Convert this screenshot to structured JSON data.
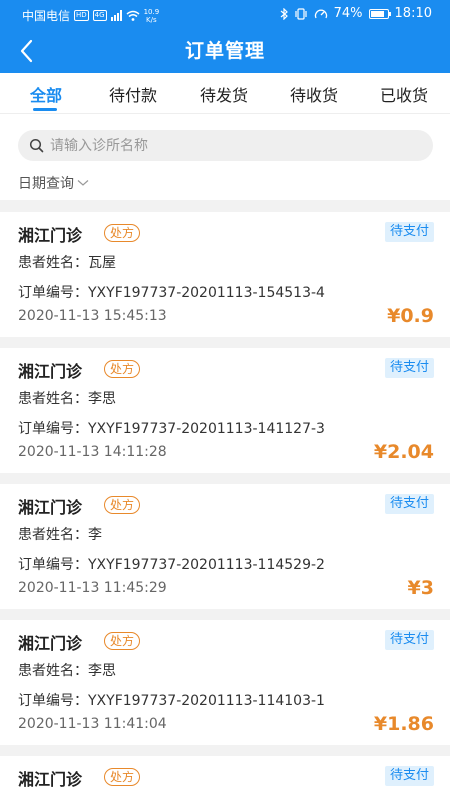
{
  "status_bar": {
    "carrier": "中国电信",
    "hd_badge": "HD",
    "net_badge": "4G",
    "speed": "10.9",
    "speed_unit": "K/s",
    "battery": "74%",
    "time": "18:10"
  },
  "nav": {
    "title": "订单管理"
  },
  "tabs": [
    {
      "label": "全部",
      "active": true
    },
    {
      "label": "待付款"
    },
    {
      "label": "待发货"
    },
    {
      "label": "待收货"
    },
    {
      "label": "已收货"
    }
  ],
  "search": {
    "placeholder": "请输入诊所名称"
  },
  "date_filter": {
    "label": "日期查询"
  },
  "orders": [
    {
      "clinic": "湘江门诊",
      "tag": "处方",
      "status": "待支付",
      "patient": "患者姓名：瓦屋",
      "order_no": "订单编号：YXYF197737-20201113-154513-4",
      "time": "2020-11-13 15:45:13",
      "price": "¥0.9"
    },
    {
      "clinic": "湘江门诊",
      "tag": "处方",
      "status": "待支付",
      "patient": "患者姓名：李思",
      "order_no": "订单编号：YXYF197737-20201113-141127-3",
      "time": "2020-11-13 14:11:28",
      "price": "¥2.04"
    },
    {
      "clinic": "湘江门诊",
      "tag": "处方",
      "status": "待支付",
      "patient": "患者姓名：李",
      "order_no": "订单编号：YXYF197737-20201113-114529-2",
      "time": "2020-11-13 11:45:29",
      "price": "¥3"
    },
    {
      "clinic": "湘江门诊",
      "tag": "处方",
      "status": "待支付",
      "patient": "患者姓名：李思",
      "order_no": "订单编号：YXYF197737-20201113-114103-1",
      "time": "2020-11-13 11:41:04",
      "price": "¥1.86"
    },
    {
      "clinic": "湘江门诊",
      "tag": "处方",
      "status": "待支付",
      "patient": "",
      "order_no": "",
      "time": "",
      "price": ""
    }
  ],
  "colors": {
    "primary": "#1a8cf0",
    "accent": "#e8892b",
    "background": "#f2f2f2"
  },
  "icons": {
    "back": "chevron-left-icon",
    "search": "search-icon",
    "date_filter": "chevron-down-icon"
  }
}
